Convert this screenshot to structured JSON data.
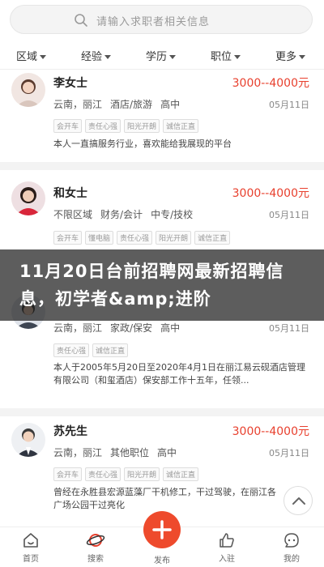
{
  "search": {
    "placeholder": "请输入求职者相关信息"
  },
  "filters": [
    {
      "label": "区域"
    },
    {
      "label": "经验"
    },
    {
      "label": "学历"
    },
    {
      "label": "职位"
    },
    {
      "label": "更多"
    }
  ],
  "cards": [
    {
      "name": "李女士",
      "salary": "3000--4000元",
      "meta": [
        "云南，丽江",
        "酒店/旅游",
        "高中"
      ],
      "date": "05月11日",
      "tags": [
        "会开车",
        "责任心强",
        "阳光开朗",
        "诚信正直"
      ],
      "desc": "本人一直搞服务行业，喜欢能给我展现的平台"
    },
    {
      "name": "和女士",
      "salary": "3000--4000元",
      "meta": [
        "不限区域",
        "财务/会计",
        "中专/技校"
      ],
      "date": "05月11日",
      "tags": [
        "会开车",
        "懂电脑",
        "责任心强",
        "阳光开朗",
        "诚信正直"
      ],
      "desc": ""
    },
    {
      "name": "",
      "salary": "",
      "meta": [
        "云南，丽江",
        "家政/保安",
        "高中"
      ],
      "date": "05月11日",
      "tags": [
        "责任心强",
        "诚信正直"
      ],
      "desc": "本人于2005年5月20日至2020年4月1日在丽江易云砚酒店管理有限公司（和玺酒店）保安部工作十五年，任领..."
    },
    {
      "name": "苏先生",
      "salary": "3000--4000元",
      "meta": [
        "云南，丽江",
        "其他职位",
        "高中"
      ],
      "date": "05月11日",
      "tags": [
        "会开车",
        "责任心强",
        "阳光开朗",
        "诚信正直"
      ],
      "desc": "曾经在永胜县宏源蓝藻厂干机修工，干过驾驶，在丽江各广场公园干过亮化"
    }
  ],
  "banner": {
    "text": "11月20日台前招聘网最新招聘信息，初学者&amp;进阶"
  },
  "nav": [
    {
      "label": "首页",
      "icon": "home-icon"
    },
    {
      "label": "搜索",
      "icon": "search-planet-icon"
    },
    {
      "label": "发布",
      "icon": "plus-icon"
    },
    {
      "label": "入驻",
      "icon": "thumbs-up-icon"
    },
    {
      "label": "我的",
      "icon": "user-chat-icon"
    }
  ],
  "colors": {
    "accent": "#e8402e",
    "publish": "#ee4a2c"
  }
}
